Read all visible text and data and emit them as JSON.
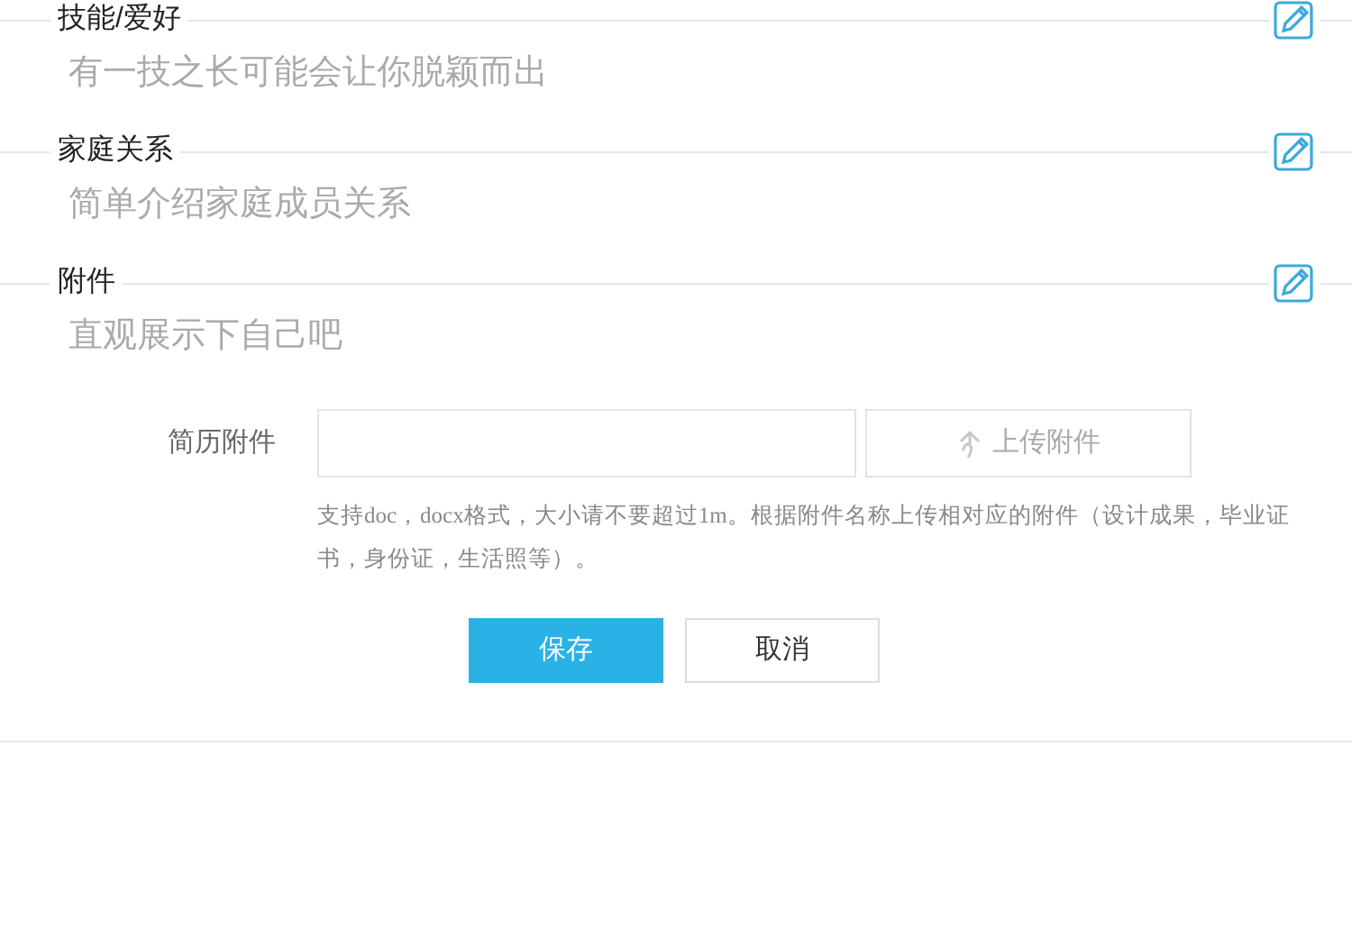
{
  "sections": [
    {
      "title": "技能/爱好",
      "hint": "有一技之长可能会让你脱颖而出"
    },
    {
      "title": "家庭关系",
      "hint": "简单介绍家庭成员关系"
    },
    {
      "title": "附件",
      "hint": "直观展示下自己吧"
    }
  ],
  "attachment": {
    "label": "简历附件",
    "upload_button": "上传附件",
    "note": "支持doc，docx格式，大小请不要超过1m。根据附件名称上传相对应的附件（设计成果，毕业证书，身份证，生活照等）。"
  },
  "buttons": {
    "save": "保存",
    "cancel": "取消"
  }
}
